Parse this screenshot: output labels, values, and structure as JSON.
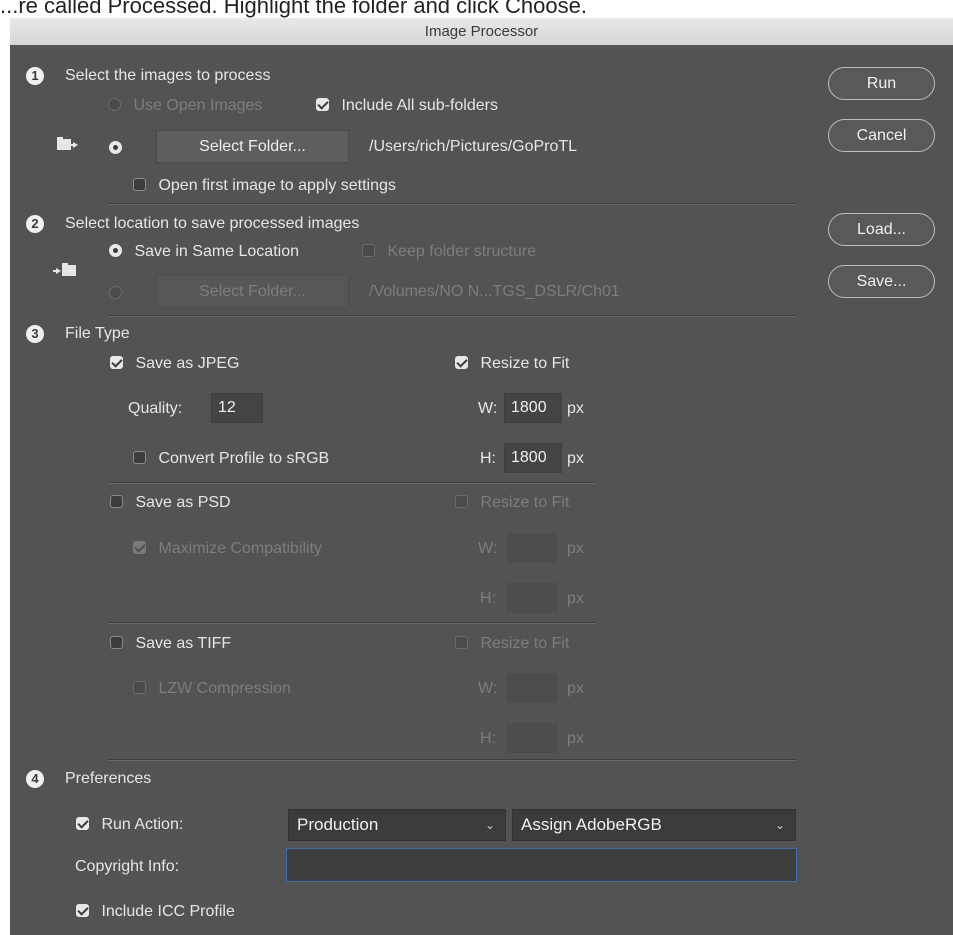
{
  "caption": "...re called Processed. Highlight the folder and click Choose.",
  "window": {
    "title": "Image Processor"
  },
  "section1": {
    "number": "1",
    "title": "Select the images to process",
    "use_open_images": "Use Open Images",
    "include_subfolders": "Include All sub-folders",
    "select_folder_button": "Select Folder...",
    "folder_path": "/Users/rich/Pictures/GoProTL",
    "open_first_image": "Open first image to apply settings"
  },
  "section2": {
    "number": "2",
    "title": "Select location to save processed images",
    "save_same_location": "Save in Same Location",
    "keep_folder_structure": "Keep folder structure",
    "select_folder_button": "Select Folder...",
    "folder_path": "/Volumes/NO N...TGS_DSLR/Ch01"
  },
  "section3": {
    "number": "3",
    "title": "File Type",
    "jpeg": {
      "save_label": "Save as JPEG",
      "resize_label": "Resize to Fit",
      "quality_label": "Quality:",
      "quality_value": "12",
      "w_label": "W:",
      "w_value": "1800",
      "w_unit": "px",
      "h_label": "H:",
      "h_value": "1800",
      "h_unit": "px",
      "convert_label": "Convert Profile to sRGB"
    },
    "psd": {
      "save_label": "Save as PSD",
      "resize_label": "Resize to Fit",
      "maximize_label": "Maximize Compatibility",
      "w_label": "W:",
      "w_unit": "px",
      "h_label": "H:",
      "h_unit": "px"
    },
    "tiff": {
      "save_label": "Save as TIFF",
      "resize_label": "Resize to Fit",
      "lzw_label": "LZW Compression",
      "w_label": "W:",
      "w_unit": "px",
      "h_label": "H:",
      "h_unit": "px"
    }
  },
  "section4": {
    "number": "4",
    "title": "Preferences",
    "run_action_label": "Run Action:",
    "action_set": "Production",
    "action_name": "Assign AdobeRGB",
    "copyright_label": "Copyright Info:",
    "copyright_value": "",
    "icc_label": "Include ICC Profile"
  },
  "buttons": {
    "run": "Run",
    "cancel": "Cancel",
    "load": "Load...",
    "save": "Save..."
  },
  "colors": {
    "dialog_bg": "#535353",
    "focus_border": "#3b6fb3"
  }
}
